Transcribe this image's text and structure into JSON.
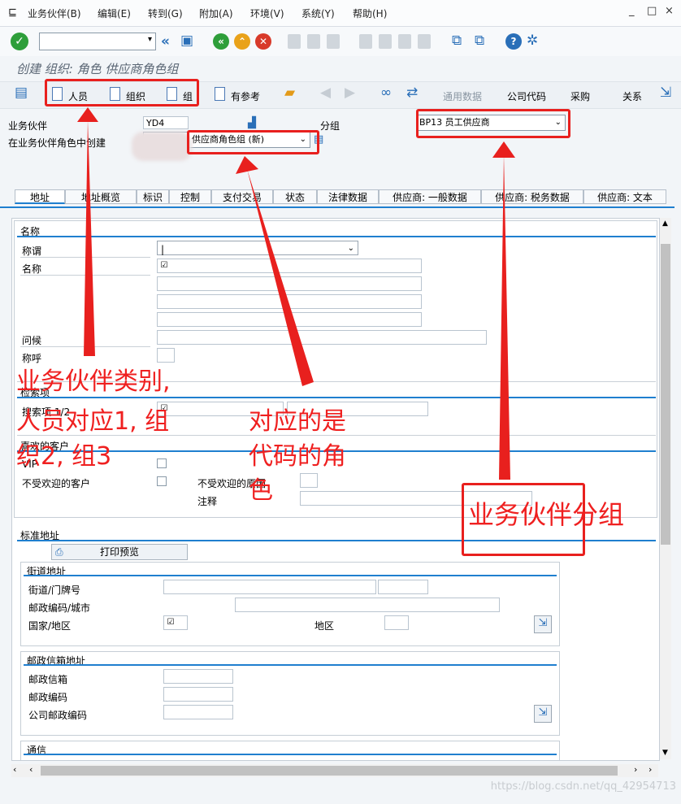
{
  "menubar": {
    "items": [
      "业务伙伴(B)",
      "编辑(E)",
      "转到(G)",
      "附加(A)",
      "环境(V)",
      "系统(Y)",
      "帮助(H)"
    ]
  },
  "window_controls": [
    "_",
    "□",
    "×"
  ],
  "title": "创建 组织: 角色 供应商角色组",
  "toolbar2": {
    "person": "人员",
    "organization": "组织",
    "group": "组",
    "with_ref": "有参考",
    "general_data": "通用数据",
    "company_code": "公司代码",
    "purchasing": "采购",
    "relationships": "关系"
  },
  "header": {
    "bp_label": "业务伙伴",
    "bp_value": "YD4",
    "group_label": "分组",
    "group_value": "BP13 员工供应商",
    "role_label": "在业务伙伴角色中创建",
    "role_value": "供应商角色组 (新)"
  },
  "tabs": [
    "地址",
    "地址概览",
    "标识",
    "控制",
    "支付交易",
    "状态",
    "法律数据",
    "供应商: 一般数据",
    "供应商: 税务数据",
    "供应商: 文本"
  ],
  "name_section": {
    "title": "名称",
    "salutation": "称谓",
    "name": "名称",
    "greeting": "问候",
    "title_label": "称呼"
  },
  "search_section": {
    "title": "检索项",
    "search_term": "搜索项 1/2"
  },
  "customer_section": {
    "title": "喜欢的客户",
    "vip": "VIP",
    "unwanted": "不受欢迎的客户",
    "reason": "不受欢迎的原因",
    "note": "注释"
  },
  "standard_address": {
    "title": "标准地址",
    "print_preview": "打印预览",
    "street_title": "街道地址",
    "street": "街道/门牌号",
    "postal_city": "邮政编码/城市",
    "country": "国家/地区",
    "region": "地区"
  },
  "po_box": {
    "title": "邮政信箱地址",
    "po_box": "邮政信箱",
    "postal_code": "邮政编码",
    "company_postal": "公司邮政编码"
  },
  "communication": {
    "title": "通信"
  },
  "annotations": {
    "type_note_line1": "业务伙伴类别,",
    "type_note_line2": "人员对应1, 组",
    "type_note_line3": "织2, 组3",
    "role_note_line1": "对应的是",
    "role_note_line2": "代码的角",
    "role_note_line3": "色",
    "group_note": "业务伙伴分组"
  },
  "watermark": "https://blog.csdn.net/qq_42954713"
}
